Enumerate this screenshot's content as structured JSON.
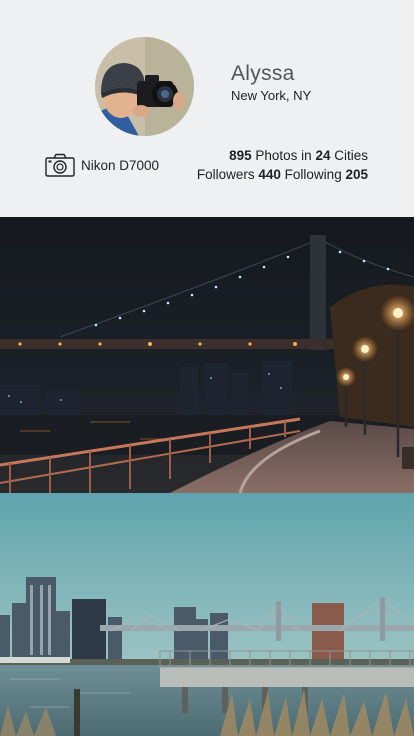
{
  "profile": {
    "name": "Alyssa",
    "location": "New York, NY",
    "camera": "Nikon D7000",
    "camera_icon": "camera-icon",
    "stats": {
      "photos_count": "895",
      "photos_label": "Photos in",
      "cities_count": "24",
      "cities_label": "Cities",
      "followers_label": "Followers",
      "followers_count": "440",
      "following_label": "Following",
      "following_count": "205"
    }
  },
  "feed": {
    "photos": [
      {
        "subject": "night-bridge-waterfront"
      },
      {
        "subject": "city-skyline-river-pier"
      }
    ]
  },
  "colors": {
    "background": "#eef0f2",
    "text": "#222222",
    "name_text": "#555555"
  }
}
